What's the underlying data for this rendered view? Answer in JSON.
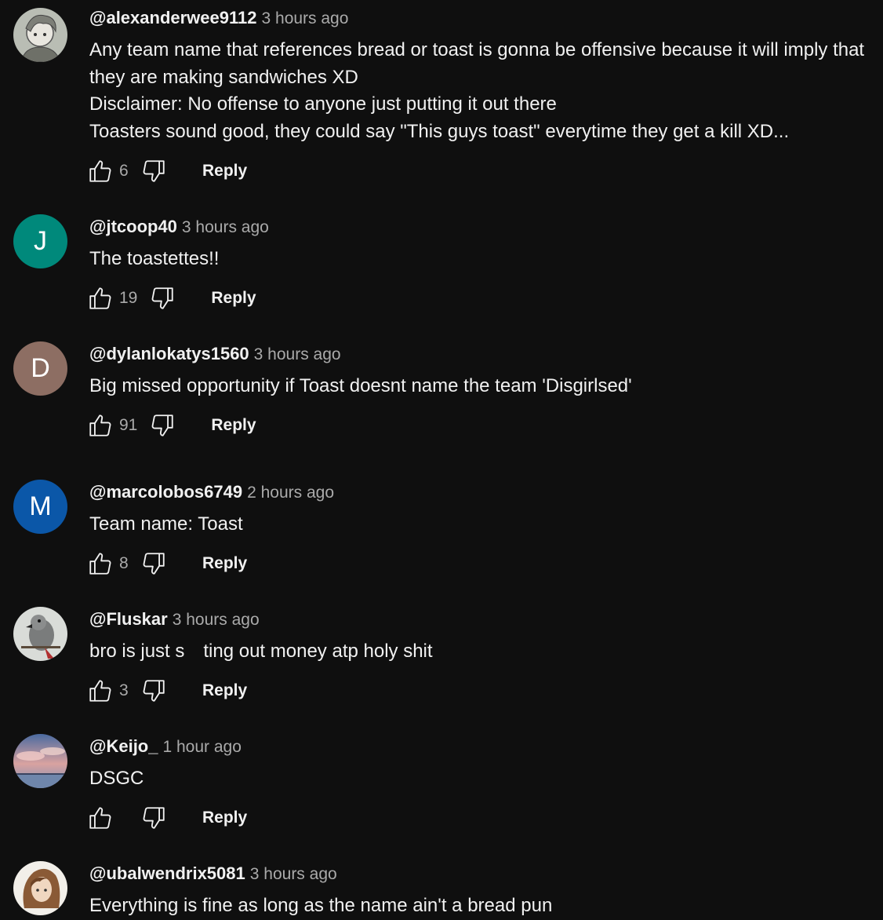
{
  "colors": {
    "background": "#0f0f0f",
    "text": "#f1f1f1",
    "muted": "#aaaaaa"
  },
  "icons": {
    "like": "thumbs-up-icon",
    "dislike": "thumbs-down-icon"
  },
  "comments": [
    {
      "author": "@alexanderwee9112",
      "time": "3 hours ago",
      "lines": [
        "Any team name that references bread or toast is gonna be offensive because it will imply that",
        "they are making sandwiches XD",
        "Disclaimer: No offense to anyone just putting it out there",
        "Toasters sound good, they could say \"This guys toast\" everytime they get a kill XD..."
      ],
      "likes": "6",
      "reply": "Reply",
      "avatar": {
        "type": "image",
        "icon": "anime-character-avatar"
      }
    },
    {
      "author": "@jtcoop40",
      "time": "3 hours ago",
      "lines": [
        "The toastettes!!"
      ],
      "likes": "19",
      "reply": "Reply",
      "avatar": {
        "type": "letter",
        "letter": "J",
        "color": "#00897b"
      }
    },
    {
      "author": "@dylanlokatys1560",
      "time": "3 hours ago",
      "lines": [
        "Big missed opportunity if Toast doesnt name the team 'Disgirlsed'"
      ],
      "likes": "91",
      "reply": "Reply",
      "avatar": {
        "type": "letter",
        "letter": "D",
        "color": "#8d6e63"
      }
    },
    {
      "author": "@marcolobos6749",
      "time": "2 hours ago",
      "lines": [
        "Team name: Toast"
      ],
      "likes": "8",
      "reply": "Reply",
      "avatar": {
        "type": "letter",
        "letter": "M",
        "color": "#0b57a8"
      }
    },
    {
      "author": "@Fluskar",
      "time": "3 hours ago",
      "line_parts": [
        "bro is just s",
        "ting out money atp holy shit"
      ],
      "likes": "3",
      "reply": "Reply",
      "avatar": {
        "type": "image",
        "icon": "parrot-avatar"
      }
    },
    {
      "author": "@Keijo_",
      "time": "1 hour ago",
      "lines": [
        "DSGC"
      ],
      "likes": "",
      "reply": "Reply",
      "avatar": {
        "type": "image",
        "icon": "sunset-sky-avatar"
      }
    },
    {
      "author": "@ubalwendrix5081",
      "time": "3 hours ago",
      "lines": [
        "Everything is fine as long as the name ain't a bread pun"
      ],
      "avatar": {
        "type": "image",
        "icon": "anime-character-avatar"
      }
    }
  ]
}
